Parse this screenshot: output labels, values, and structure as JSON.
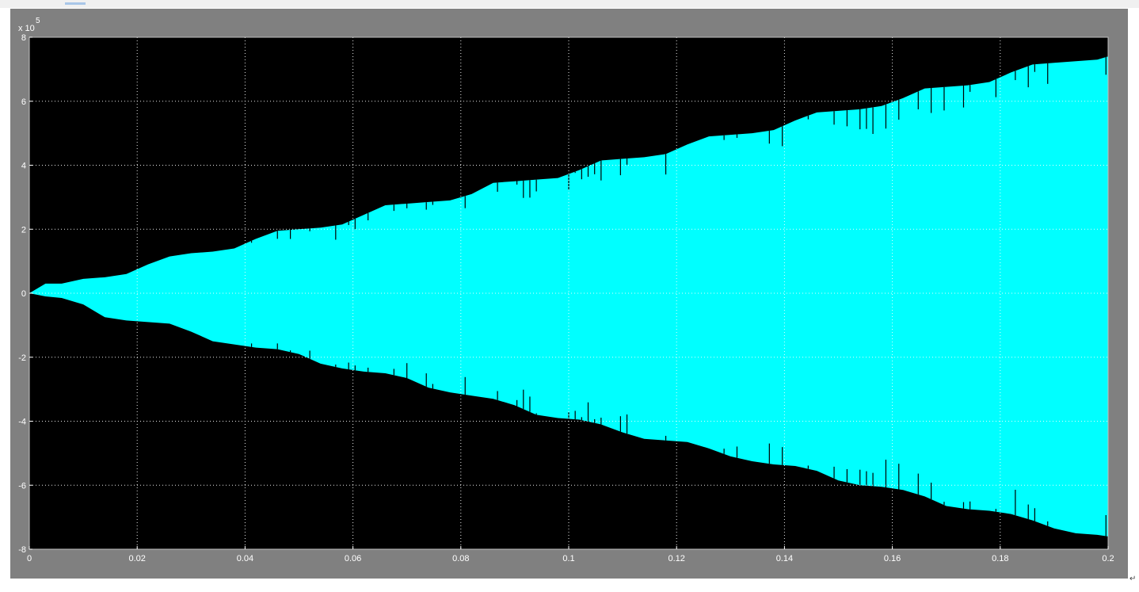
{
  "window": {
    "corner_glyph": "↵"
  },
  "chart_data": {
    "type": "area",
    "title": "",
    "xlabel": "",
    "ylabel": "",
    "y_exponent_label": "x 10",
    "y_exponent_power": "5",
    "xlim": [
      0,
      0.2
    ],
    "ylim": [
      -8,
      8
    ],
    "y_scale_note": "x 10^5",
    "grid": true,
    "x_ticks": [
      "0",
      "0.02",
      "0.04",
      "0.06",
      "0.08",
      "0.1",
      "0.12",
      "0.14",
      "0.16",
      "0.18",
      "0.2"
    ],
    "y_ticks": [
      "8",
      "6",
      "4",
      "2",
      "0",
      "-2",
      "-4",
      "-6",
      "-8"
    ],
    "colors": {
      "background": "#000000",
      "signal": "#00ffff",
      "frame": "#808080",
      "grid": "#ffffff",
      "text": "#ffffff"
    },
    "series": [
      {
        "envelope_upper": {
          "x": [
            0,
            0.003,
            0.006,
            0.01,
            0.014,
            0.018,
            0.022,
            0.026,
            0.03,
            0.034,
            0.038,
            0.042,
            0.046,
            0.05,
            0.054,
            0.058,
            0.062,
            0.066,
            0.07,
            0.074,
            0.078,
            0.082,
            0.086,
            0.09,
            0.094,
            0.098,
            0.102,
            0.106,
            0.11,
            0.114,
            0.118,
            0.122,
            0.126,
            0.13,
            0.134,
            0.138,
            0.142,
            0.146,
            0.15,
            0.154,
            0.158,
            0.162,
            0.166,
            0.17,
            0.174,
            0.178,
            0.182,
            0.186,
            0.19,
            0.194,
            0.198,
            0.2
          ],
          "y": [
            0,
            0.3,
            0.3,
            0.45,
            0.5,
            0.6,
            0.9,
            1.15,
            1.25,
            1.3,
            1.4,
            1.7,
            1.95,
            2.0,
            2.05,
            2.15,
            2.45,
            2.75,
            2.8,
            2.85,
            2.9,
            3.1,
            3.45,
            3.5,
            3.55,
            3.6,
            3.85,
            4.15,
            4.2,
            4.25,
            4.35,
            4.65,
            4.9,
            4.95,
            5.0,
            5.1,
            5.4,
            5.65,
            5.7,
            5.75,
            5.85,
            6.1,
            6.4,
            6.45,
            6.5,
            6.6,
            6.9,
            7.15,
            7.2,
            7.25,
            7.3,
            7.4
          ]
        },
        "envelope_lower": {
          "x": [
            0,
            0.003,
            0.006,
            0.01,
            0.014,
            0.018,
            0.022,
            0.026,
            0.03,
            0.034,
            0.038,
            0.042,
            0.046,
            0.05,
            0.054,
            0.058,
            0.062,
            0.066,
            0.07,
            0.074,
            0.078,
            0.082,
            0.086,
            0.09,
            0.094,
            0.098,
            0.102,
            0.106,
            0.11,
            0.114,
            0.118,
            0.122,
            0.126,
            0.13,
            0.134,
            0.138,
            0.142,
            0.146,
            0.15,
            0.154,
            0.158,
            0.162,
            0.166,
            0.17,
            0.174,
            0.178,
            0.182,
            0.186,
            0.19,
            0.194,
            0.198,
            0.2
          ],
          "y": [
            0,
            -0.1,
            -0.15,
            -0.35,
            -0.75,
            -0.85,
            -0.9,
            -0.95,
            -1.2,
            -1.5,
            -1.6,
            -1.7,
            -1.75,
            -1.9,
            -2.2,
            -2.35,
            -2.45,
            -2.5,
            -2.65,
            -2.95,
            -3.1,
            -3.2,
            -3.3,
            -3.5,
            -3.8,
            -3.9,
            -3.95,
            -4.1,
            -4.35,
            -4.55,
            -4.6,
            -4.65,
            -4.85,
            -5.1,
            -5.25,
            -5.35,
            -5.4,
            -5.55,
            -5.85,
            -6.0,
            -6.05,
            -6.15,
            -6.35,
            -6.65,
            -6.75,
            -6.8,
            -6.9,
            -7.1,
            -7.35,
            -7.5,
            -7.55,
            -7.6
          ]
        }
      }
    ]
  }
}
